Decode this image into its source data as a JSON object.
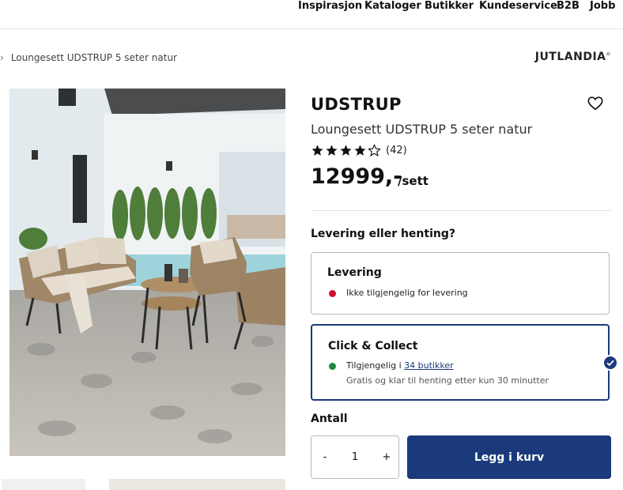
{
  "nav": {
    "items": [
      "Inspirasjon",
      "Kataloger",
      "Butikker",
      "Kundeservice",
      "B2B",
      "Jobb"
    ]
  },
  "breadcrumb": {
    "label": "Loungesett UDSTRUP 5 seter natur"
  },
  "logo": {
    "text": "JUTLANDIA",
    "mark": "®"
  },
  "product": {
    "brand": "UDSTRUP",
    "name": "Loungesett UDSTRUP 5 seter natur",
    "rating": 4,
    "rating_max": 5,
    "review_count": "(42)",
    "price": "12999,-",
    "unit": "/sett"
  },
  "delivery": {
    "heading": "Levering eller henting?",
    "options": [
      {
        "title": "Levering",
        "status": "Ikke tilgjengelig for levering",
        "status_color": "#d0102a"
      },
      {
        "title": "Click & Collect",
        "status_prefix": "Tilgjengelig i ",
        "stores_link": "34 butikker",
        "note": "Gratis og klar til henting etter kun 30 minutter",
        "status_color": "#1e8a3c",
        "selected": true
      }
    ]
  },
  "quantity": {
    "label": "Antall",
    "value": "1",
    "minus": "-",
    "plus": "+"
  },
  "cart": {
    "label": "Legg i kurv"
  },
  "colors": {
    "primary": "#1a3a7c",
    "unavailable": "#d0102a",
    "available": "#1e8a3c"
  },
  "icons": [
    "chevron-right-icon",
    "heart-icon",
    "star-icon",
    "checkmark-icon"
  ]
}
